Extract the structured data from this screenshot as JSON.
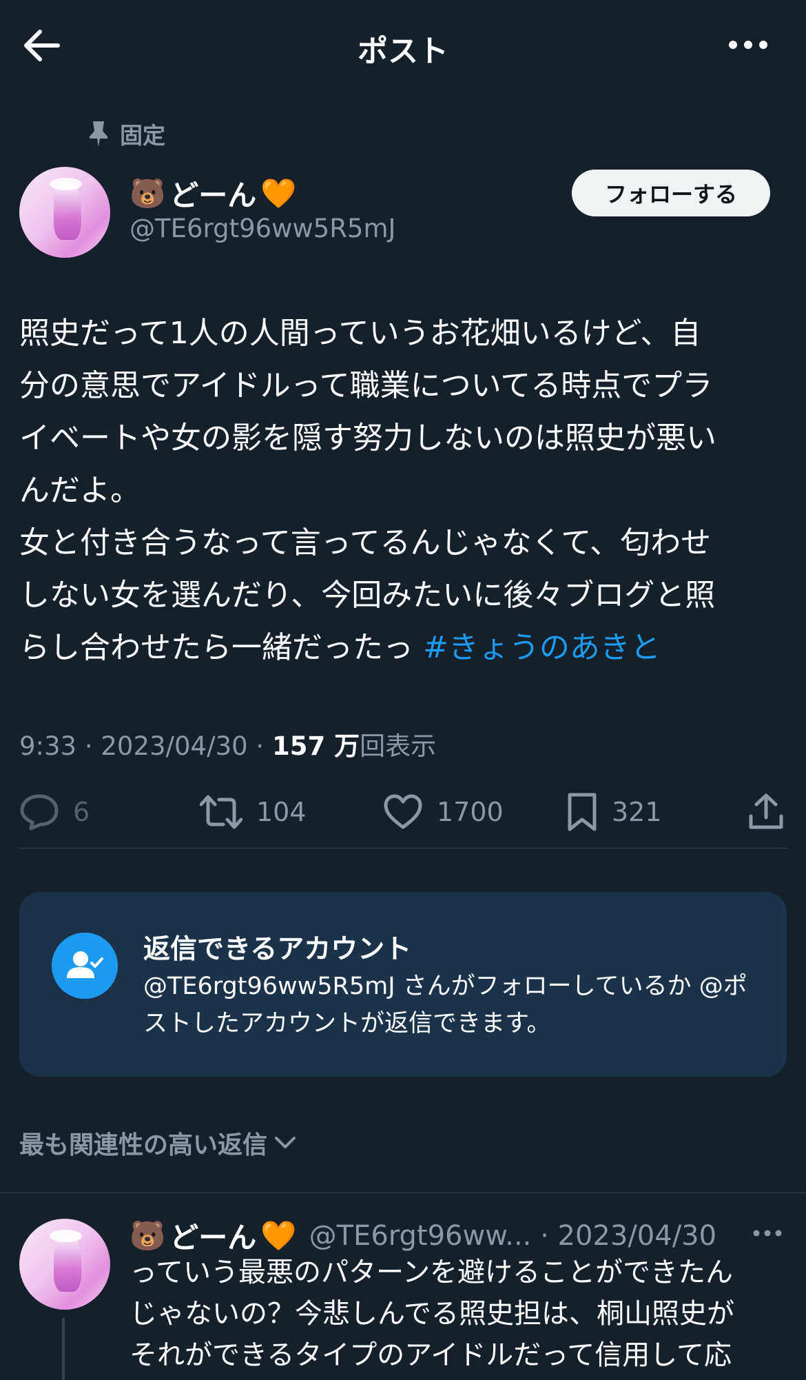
{
  "header": {
    "title": "ポスト",
    "back_icon": "arrow-left-icon",
    "more_icon": "more-horizontal-icon"
  },
  "post": {
    "pinned_label": "固定",
    "author": {
      "name": "どーん",
      "emoji_prefix": "🐻",
      "emoji_suffix": "🧡",
      "handle": "@TE6rgt96ww5R5mJ"
    },
    "follow_label": "フォローする",
    "text": "照史だって1人の人間っていうお花畑いるけど、自\n分の意思でアイドルって職業についてる時点でプラ\nイベートや女の影を隠す努力しないのは照史が悪い\nんだよ。\n女と付き合うなって言ってるんじゃなくて、匂わせ\nしない女を選んだり、今回みたいに後々ブログと照\nらし合わせたら一緒だったっ ",
    "hashtag": "#きょうのあきと",
    "time": "9:33",
    "date": "2023/04/30",
    "views_count": "157 万",
    "views_label": "回表示",
    "stats": {
      "replies": "6",
      "reposts": "104",
      "likes": "1700",
      "bookmarks": "321"
    }
  },
  "reply_restriction": {
    "title": "返信できるアカウント",
    "body": "@TE6rgt96ww5R5mJ さんがフォローしているか @ポストしたアカウントが返信できます。"
  },
  "sort_label": "最も関連性の高い返信",
  "reply": {
    "name": "どーん",
    "emoji_prefix": "🐻",
    "emoji_suffix": "🧡",
    "handle_date": "@TE6rgt96ww... · 2023/04/30",
    "text": "っていう最悪のパターンを避けることができたん\nじゃないの？今悲しんでる照史担は、桐山照史が\nそれができるタイプのアイドルだって信用して応"
  },
  "colors": {
    "background": "#15202b",
    "accent": "#1d9bf0",
    "muted": "#8b98a5",
    "card": "#1b3249"
  }
}
